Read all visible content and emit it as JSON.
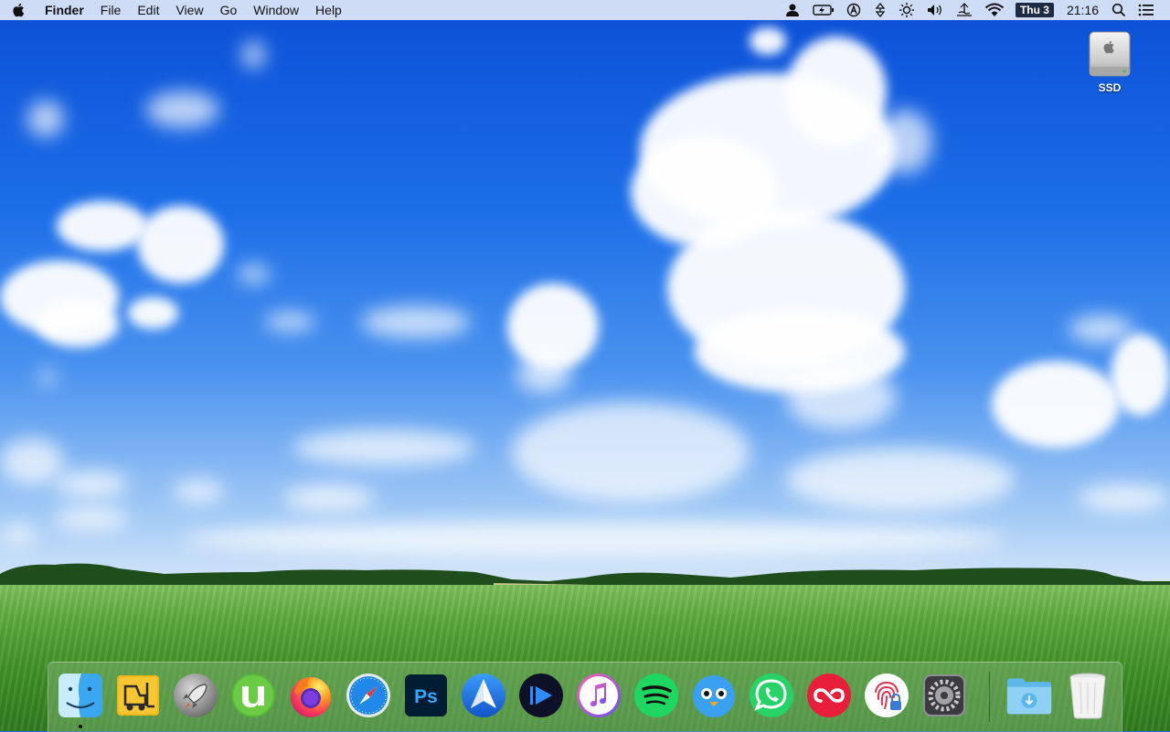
{
  "menubar": {
    "app_name": "Finder",
    "menus": [
      "File",
      "Edit",
      "View",
      "Go",
      "Window",
      "Help"
    ],
    "status_icons": [
      "user-icon",
      "battery-charging-icon",
      "ampere-icon",
      "transfer-icon",
      "brightness-icon",
      "volume-icon",
      "keyboard-icon",
      "wifi-icon"
    ],
    "date_badge": "Thu 3",
    "time": "21:16",
    "right_icons": [
      "spotlight-search-icon",
      "notification-center-icon"
    ]
  },
  "desktop": {
    "icons": [
      {
        "label": "SSD",
        "icon": "external-drive-icon"
      }
    ]
  },
  "dock": {
    "apps": [
      {
        "name": "Finder",
        "icon": "finder-icon",
        "running": true
      },
      {
        "name": "Forklift",
        "icon": "forklift-icon"
      },
      {
        "name": "Launchpad",
        "icon": "launchpad-icon"
      },
      {
        "name": "uTorrent",
        "icon": "utorrent-icon"
      },
      {
        "name": "Firefox",
        "icon": "firefox-icon"
      },
      {
        "name": "Safari",
        "icon": "safari-icon"
      },
      {
        "name": "Photoshop",
        "icon": "photoshop-icon",
        "text": "Ps"
      },
      {
        "name": "Spark",
        "icon": "spark-mail-icon"
      },
      {
        "name": "Infuse",
        "icon": "infuse-icon"
      },
      {
        "name": "iTunes",
        "icon": "itunes-icon"
      },
      {
        "name": "Spotify",
        "icon": "spotify-icon"
      },
      {
        "name": "Tweetbot",
        "icon": "tweetbot-icon"
      },
      {
        "name": "WhatsApp",
        "icon": "whatsapp-icon"
      },
      {
        "name": "Creative Cloud",
        "icon": "creative-cloud-icon"
      },
      {
        "name": "Privacy",
        "icon": "fingerprint-lock-icon"
      },
      {
        "name": "System Preferences",
        "icon": "system-preferences-icon"
      },
      {
        "name": "Downloads",
        "icon": "downloads-folder-icon"
      },
      {
        "name": "Trash",
        "icon": "trash-icon"
      }
    ]
  },
  "colors": {
    "menubar_bg": "#e1e8f8",
    "sky_top": "#0b4fd6",
    "field": "#4e9e32",
    "dock_bg": "#78af6e"
  }
}
